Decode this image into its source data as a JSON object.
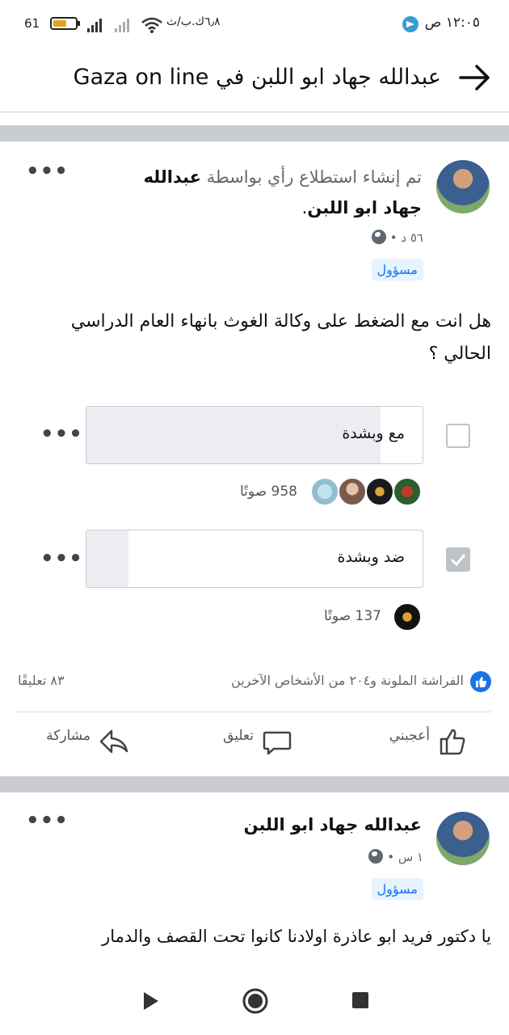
{
  "status_bar": {
    "time": "١٢:٠٥ ص",
    "network_speed": "٦٫٨ك.ب/ث",
    "battery_pct": "61"
  },
  "header": {
    "title": "عبدالله جهاد ابو اللبن في Gaza on line"
  },
  "post1": {
    "headline_prefix": "تم إنشاء استطلاع رأي بواسطة",
    "author_name_part1": "عبدالله",
    "author_name_part2": "جهاد ابو اللبن",
    "period": ".",
    "time": "٥٦ د",
    "dot": "•",
    "role_badge": "مسؤول",
    "question": "هل انت مع الضغط على وكالة الغوث بانهاء العام الدراسي الحالي ؟",
    "options": [
      {
        "label": "مع وبشدة",
        "votes": "958 صوتًا",
        "checked": false,
        "share": 0.875
      },
      {
        "label": "ضد وبشدة",
        "votes": "137 صوتًا",
        "checked": true,
        "share": 0.125
      }
    ],
    "reactions_text": "الفراشة الملونة و٢٠٤ من الأشخاص الآخرين",
    "comments_count": "٨٣ تعليقًا",
    "actions": {
      "like": "أعجبني",
      "comment": "تعليق",
      "share": "مشاركة"
    },
    "more": "•••"
  },
  "post2": {
    "author_name": "عبدالله جهاد ابو اللبن",
    "time": "١ س",
    "dot": "•",
    "role_badge": "مسؤول",
    "text": "يا دكتور فريد ابو عاذرة اولادنا كانوا تحت القصف والدمار",
    "more": "•••"
  },
  "colors": {
    "accent": "#1b74e4",
    "badge_bg": "#e7f3ff",
    "separator": "#c9ccd1"
  }
}
